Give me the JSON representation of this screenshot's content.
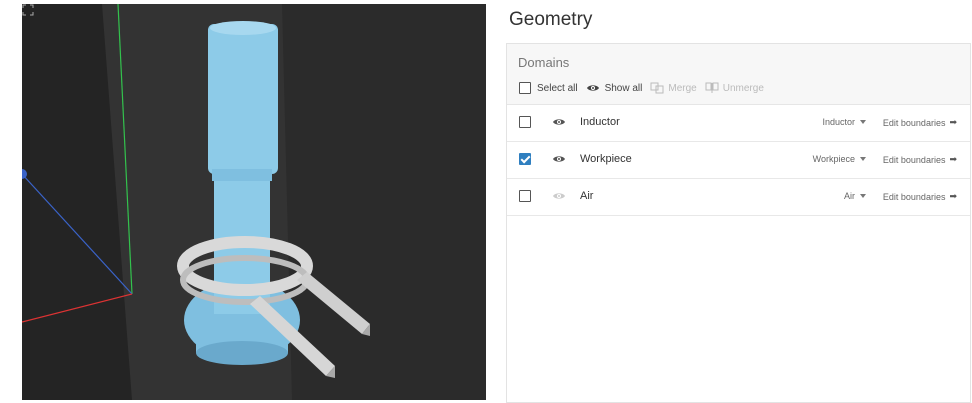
{
  "panel": {
    "title": "Geometry"
  },
  "domains": {
    "header": "Domains",
    "toolbar": {
      "select_all": "Select all",
      "show_all": "Show all",
      "merge": "Merge",
      "unmerge": "Unmerge"
    },
    "rows": [
      {
        "name": "Inductor",
        "material": "Inductor",
        "edit": "Edit boundaries",
        "checked": false,
        "visible": true
      },
      {
        "name": "Workpiece",
        "material": "Workpiece",
        "edit": "Edit boundaries",
        "checked": true,
        "visible": true
      },
      {
        "name": "Air",
        "material": "Air",
        "edit": "Edit boundaries",
        "checked": false,
        "visible": false
      }
    ]
  },
  "colors": {
    "accent": "#2f7fc0",
    "workpiece": "#8dcbe8",
    "inductor": "#d9d9d9",
    "viewport_bg": "#2b2b2b"
  },
  "icons": {
    "eye": "eye-icon",
    "merge": "merge-icon",
    "unmerge": "unmerge-icon",
    "fullscreen": "fullscreen-icon",
    "arrow": "arrow-right-icon",
    "caret": "caret-down-icon"
  }
}
